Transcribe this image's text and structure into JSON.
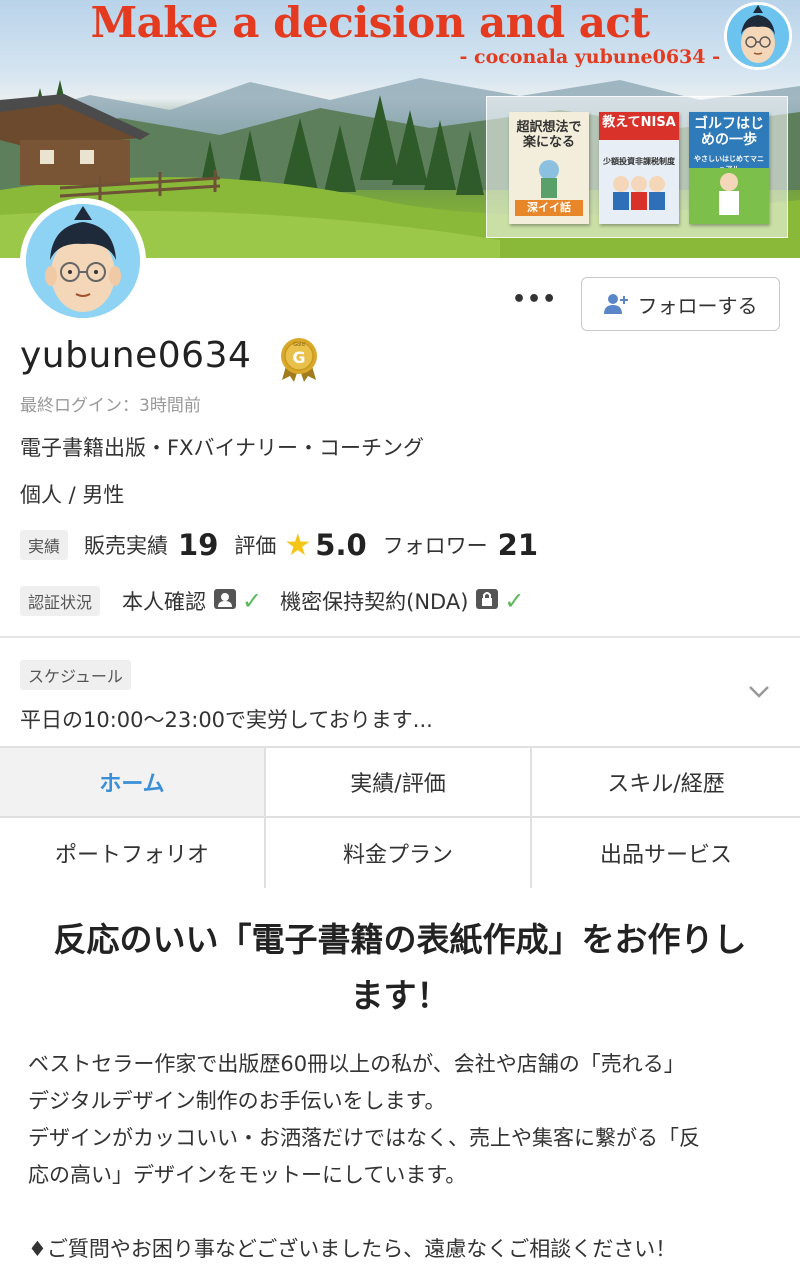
{
  "banner": {
    "title": "Make a decision and act",
    "subtitle": "- coconala yubune0634 -",
    "books": [
      {
        "title": "超訳想法で楽になる",
        "sub": "深イイ話"
      },
      {
        "title": "教えてNISA",
        "sub": "少額投資非課税制度"
      },
      {
        "title": "ゴルフはじめの一歩",
        "sub": "やさしいはじめてマニュアル"
      }
    ]
  },
  "profile": {
    "more_label": "•••",
    "follow_label": "フォローする",
    "username": "yubune0634",
    "rank_badge": "G",
    "rank_badge_top": "Gold",
    "last_login": "最終ログイン：3時間前",
    "tagline": "電子書籍出版・FXバイナリー・コーチング",
    "type_gender": "個人 / 男性"
  },
  "stats": {
    "tag": "実績",
    "sales_label": "販売実績",
    "sales_value": "19",
    "rating_label": "評価",
    "rating_value": "5.0",
    "followers_label": "フォロワー",
    "followers_value": "21"
  },
  "verification": {
    "tag": "認証状況",
    "identity_label": "本人確認",
    "nda_label": "機密保持契約(NDA)"
  },
  "schedule": {
    "tag": "スケジュール",
    "text": "平日の10:00〜23:00で実労しております..."
  },
  "tabs": [
    {
      "label": "ホーム",
      "active": true
    },
    {
      "label": "実績/評価",
      "active": false
    },
    {
      "label": "スキル/経歴",
      "active": false
    },
    {
      "label": "ポートフォリオ",
      "active": false
    },
    {
      "label": "料金プラン",
      "active": false
    },
    {
      "label": "出品サービス",
      "active": false
    }
  ],
  "content": {
    "headline_line1": "反応のいい「電子書籍の表紙作成」をお作りし",
    "headline_line2": "ます！",
    "paragraph_lines": [
      "ベストセラー作家で出版歴60冊以上の私が、会社や店舗の「売れる」",
      "デジタルデザイン制作のお手伝いをします。",
      "デザインがカッコいい・お洒落だけではなく、売上や集客に繋がる「反",
      "応の高い」デザインをモットーにしています。",
      "",
      "♦ご質問やお困り事などございましたら、遠慮なくご相談ください！"
    ]
  },
  "colors": {
    "accent": "#3b8fd6",
    "banner_title": "#e43a1f",
    "star": "#f5c518",
    "check": "#5cb85c"
  }
}
